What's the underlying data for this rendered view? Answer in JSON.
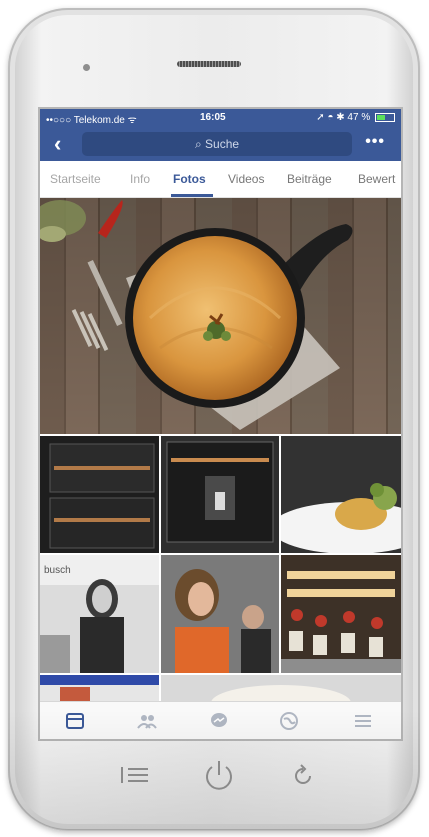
{
  "status_bar": {
    "carrier": "••○○○ Telekom.de ᯤ",
    "time": "16:05",
    "right_indicators": "➚ ◓ ✱ 47 %"
  },
  "nav": {
    "back_icon": "chevron-left-icon",
    "search_placeholder": "Suche",
    "more_label": "•••"
  },
  "tabs": [
    {
      "label": "Startseite"
    },
    {
      "label": "Info"
    },
    {
      "label": "Fotos"
    },
    {
      "label": "Videos"
    },
    {
      "label": "Beiträge"
    },
    {
      "label": "Bewert"
    }
  ],
  "active_tab": "Fotos",
  "tabbar_icons": [
    "feed-icon",
    "friends-icon",
    "messenger-icon",
    "globe-icon",
    "menu-icon"
  ],
  "hardware_icons": [
    "list-icon",
    "power-icon",
    "refresh-icon"
  ],
  "colors": {
    "facebook_blue": "#3b5998",
    "battery_green": "#5ce05c"
  }
}
